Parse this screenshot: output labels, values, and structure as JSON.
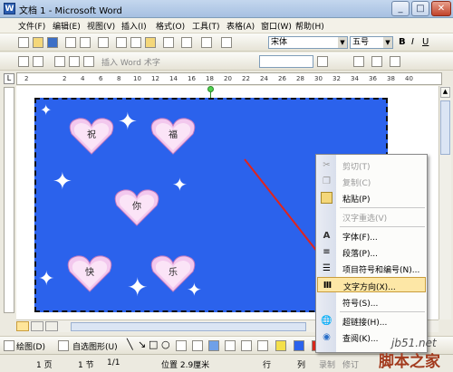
{
  "window": {
    "title": "文档 1 - Microsoft Word",
    "minimize": "_",
    "maximize": "□",
    "close": "✕"
  },
  "menu": [
    "文件(F)",
    "编辑(E)",
    "视图(V)",
    "插入(I)",
    "格式(O)",
    "工具(T)",
    "表格(A)",
    "窗口(W)",
    "帮助(H)"
  ],
  "toolbar": {
    "font": "宋体",
    "size": "五号",
    "bold": "B",
    "italic": "I",
    "underline": "U"
  },
  "toolbar2": {
    "insert_word_art": "插入 Word 术字"
  },
  "ruler": {
    "ticks": [
      "2",
      "2",
      "4",
      "6",
      "8",
      "10",
      "12",
      "14",
      "16",
      "18",
      "20",
      "22",
      "24",
      "26",
      "28",
      "30",
      "32",
      "34",
      "36",
      "38",
      "40"
    ]
  },
  "canvas": {
    "hearts": [
      {
        "label": "祝"
      },
      {
        "label": "福"
      },
      {
        "label": "你"
      },
      {
        "label": "快"
      },
      {
        "label": "乐"
      }
    ]
  },
  "context_menu": {
    "items": [
      {
        "label": "剪切(T)",
        "icon": "scissors-icon",
        "enabled": false
      },
      {
        "label": "复制(C)",
        "icon": "copy-icon",
        "enabled": false
      },
      {
        "label": "粘贴(P)",
        "icon": "paste-icon",
        "enabled": true
      },
      {
        "label": "汉字重选(V)",
        "icon": "",
        "enabled": false
      },
      {
        "label": "字体(F)...",
        "icon": "font-icon",
        "enabled": true
      },
      {
        "label": "段落(P)...",
        "icon": "paragraph-icon",
        "enabled": true
      },
      {
        "label": "项目符号和编号(N)...",
        "icon": "bullets-icon",
        "enabled": true
      },
      {
        "label": "文字方向(X)...",
        "icon": "text-direction-icon",
        "enabled": true,
        "highlighted": true
      },
      {
        "label": "符号(S)...",
        "icon": "",
        "enabled": true
      },
      {
        "label": "超链接(H)...",
        "icon": "hyperlink-icon",
        "enabled": true
      },
      {
        "label": "查阅(K)...",
        "icon": "research-icon",
        "enabled": true
      }
    ]
  },
  "drawbar": {
    "draw": "绘图(D)",
    "autoshapes": "自选图形(U)"
  },
  "status": {
    "page": "1 页",
    "section": "1 节",
    "pages": "1/1",
    "position": "位置 2.9厘米",
    "line": "行",
    "column": "列",
    "rec": "录制",
    "rev": "修订"
  },
  "watermark": {
    "site": "jb51.net",
    "name": "脚本之家"
  }
}
